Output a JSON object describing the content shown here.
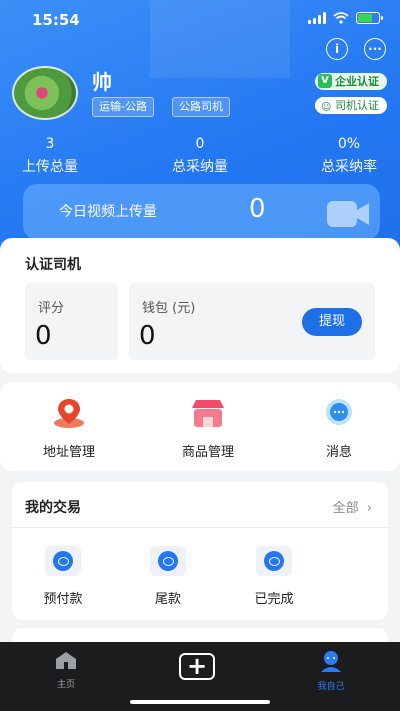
{
  "status_bar": {
    "time": "15:54"
  },
  "profile": {
    "name": "帅",
    "tags": [
      "运输-公路",
      "公路司机"
    ],
    "badges": {
      "enterprise": "企业认证",
      "enterprise_mark": "V",
      "driver": "司机认证"
    }
  },
  "stats": [
    {
      "value": "3",
      "label": "上传总量"
    },
    {
      "value": "0",
      "label": "总采纳量"
    },
    {
      "value": "0%",
      "label": "总采纳率"
    }
  ],
  "upload_today": {
    "label": "今日视频上传量",
    "count": "0"
  },
  "driver_cert": {
    "title": "认证司机",
    "score": {
      "label": "评分",
      "value": "0"
    },
    "wallet": {
      "label": "钱包 (元)",
      "value": "0",
      "action": "提现"
    }
  },
  "menu": [
    {
      "label": "地址管理",
      "icon": "location-pin-icon"
    },
    {
      "label": "商品管理",
      "icon": "shop-icon"
    },
    {
      "label": "消息",
      "icon": "message-icon"
    }
  ],
  "trades": {
    "title": "我的交易",
    "all_link": "全部",
    "items": [
      {
        "label": "预付款",
        "icon": "prepay-icon"
      },
      {
        "label": "尾款",
        "icon": "balance-payment-icon"
      },
      {
        "label": "已完成",
        "icon": "completed-icon"
      }
    ]
  },
  "tabbar": {
    "items": [
      {
        "label": "主页",
        "icon": "home-icon"
      },
      {
        "label": "",
        "icon": "plus-icon"
      },
      {
        "label": "我自己",
        "icon": "profile-icon"
      }
    ],
    "active_color": "#2a7cf7"
  },
  "colors": {
    "primary": "#1f6fe6",
    "header_gradient_start": "#3d8ff7",
    "enterprise_green": "#2dbb5b"
  }
}
